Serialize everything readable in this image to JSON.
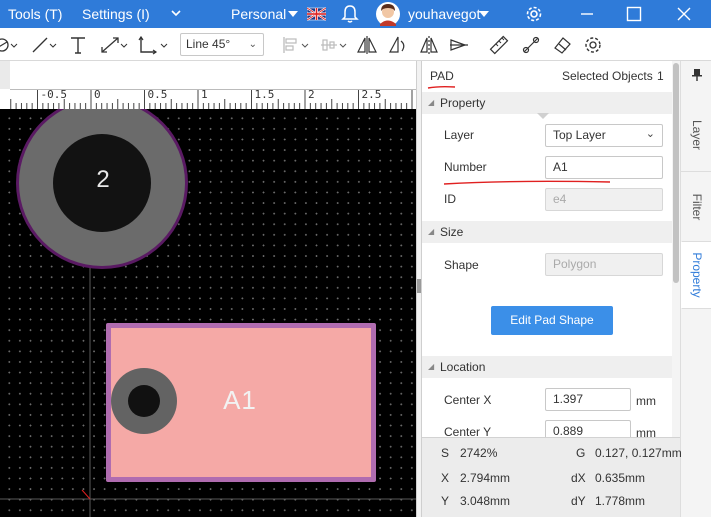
{
  "topbar": {
    "tools_menu": "Tools (T)",
    "settings_menu": "Settings (I)",
    "workspace": "Personal",
    "username": "youhavegot"
  },
  "toolbar": {
    "line_mode": "Line 45°"
  },
  "ruler": {
    "ticks": [
      "-0.5",
      "0",
      "0.5",
      "1",
      "1.5",
      "2",
      "2.5"
    ]
  },
  "canvas": {
    "via_label": "2",
    "pad_label": "A1"
  },
  "panel": {
    "object_type": "PAD",
    "selected_label": "Selected Objects",
    "selected_count": "1",
    "property_section": "Property",
    "layer_label": "Layer",
    "layer_value": "Top Layer",
    "number_label": "Number",
    "number_value": "A1",
    "id_label": "ID",
    "id_value": "e4",
    "size_section": "Size",
    "shape_label": "Shape",
    "shape_value": "Polygon",
    "edit_button": "Edit Pad Shape",
    "location_section": "Location",
    "center_x_label": "Center X",
    "center_x_value": "1.397",
    "center_y_label": "Center Y",
    "center_y_value": "0.889",
    "unit": "mm"
  },
  "vtabs": [
    "Layer",
    "Filter",
    "Property"
  ],
  "status": {
    "s_label": "S",
    "s_value": "2742%",
    "g_label": "G",
    "g_value": "0.127, 0.127mm",
    "x_label": "X",
    "x_value": "2.794mm",
    "dx_label": "dX",
    "dx_value": "0.635mm",
    "y_label": "Y",
    "y_value": "3.048mm",
    "dy_label": "dY",
    "dy_value": "1.778mm"
  },
  "colors": {
    "topbar": "#2f7bd9",
    "pad_fill": "#f5a9a6",
    "pad_border": "#b06cb0",
    "via_ring": "#6b6b6b",
    "via_outline": "#4a1050",
    "annotation_red": "#e02020",
    "button_blue": "#3b8fe8"
  }
}
